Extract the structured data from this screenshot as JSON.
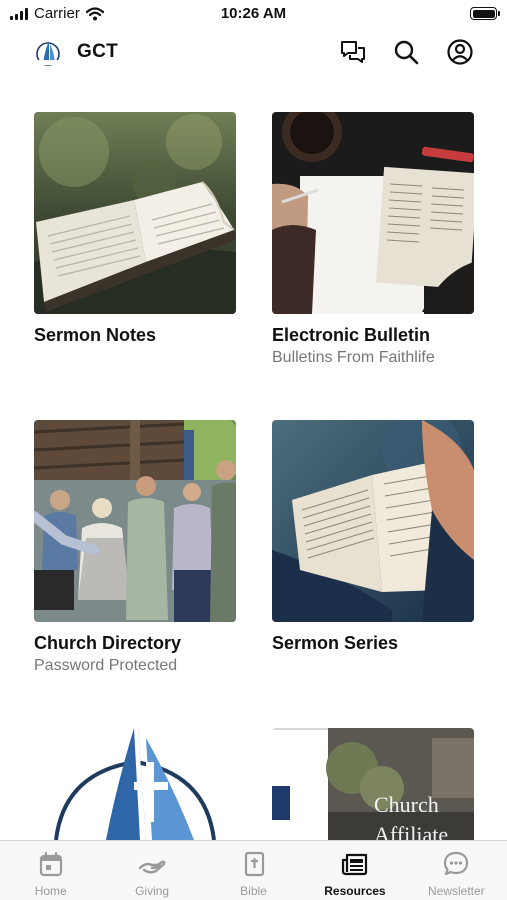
{
  "status_bar": {
    "carrier": "Carrier",
    "time": "10:26 AM"
  },
  "header": {
    "app_title": "GCT"
  },
  "cards": [
    {
      "title": "Sermon Notes",
      "subtitle": ""
    },
    {
      "title": "Electronic Bulletin",
      "subtitle": "Bulletins From Faithlife"
    },
    {
      "title": "Church Directory",
      "subtitle": "Password Protected"
    },
    {
      "title": "Sermon Series",
      "subtitle": ""
    }
  ],
  "partial_cards": {
    "affiliate_line1": "Church",
    "affiliate_line2": "Affiliate"
  },
  "tabbar": {
    "tabs": [
      {
        "label": "Home",
        "icon": "calendar-icon"
      },
      {
        "label": "Giving",
        "icon": "giving-hand-icon"
      },
      {
        "label": "Bible",
        "icon": "bible-icon"
      },
      {
        "label": "Resources",
        "icon": "newspaper-icon",
        "active": true
      },
      {
        "label": "Newsletter",
        "icon": "chat-bubble-icon"
      }
    ]
  },
  "colors": {
    "brand_blue": "#2b6cb0",
    "brand_navy": "#1e3a5f",
    "inactive_gray": "#9a9a9a"
  }
}
